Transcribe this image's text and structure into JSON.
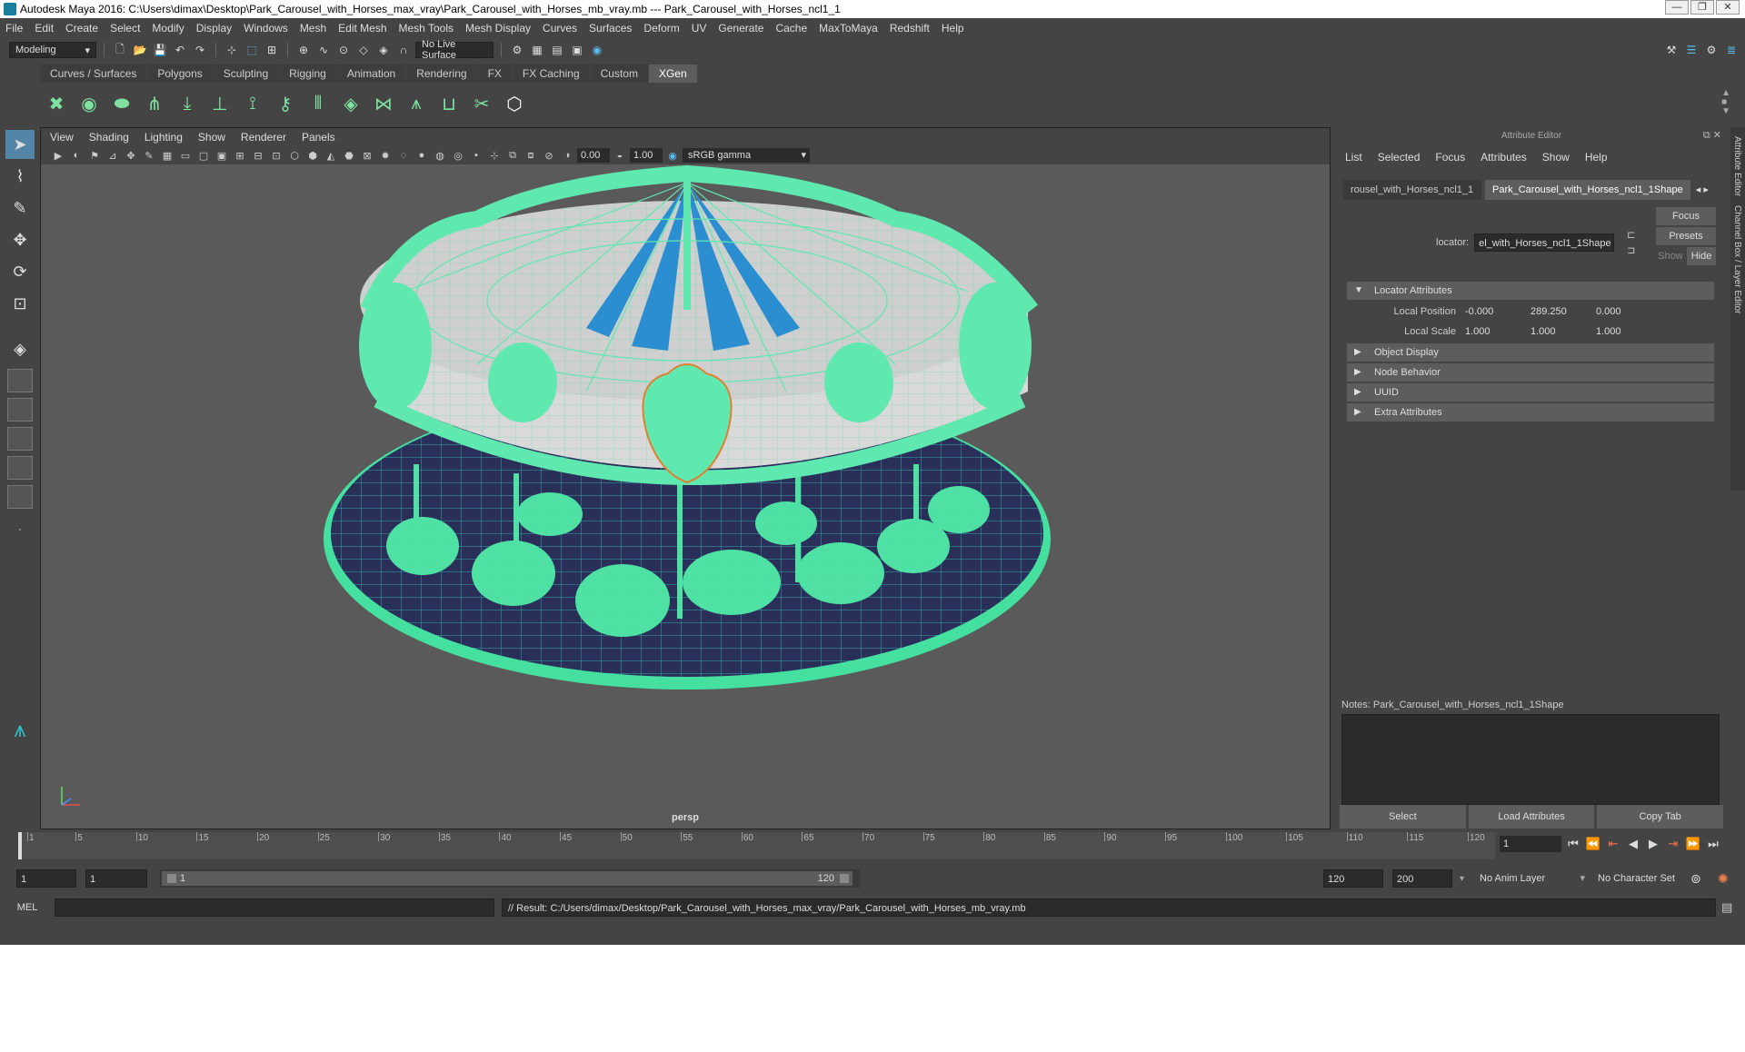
{
  "titlebar": {
    "title": "Autodesk Maya 2016: C:\\Users\\dimax\\Desktop\\Park_Carousel_with_Horses_max_vray\\Park_Carousel_with_Horses_mb_vray.mb  ---  Park_Carousel_with_Horses_ncl1_1"
  },
  "menubar": [
    "File",
    "Edit",
    "Create",
    "Select",
    "Modify",
    "Display",
    "Windows",
    "Mesh",
    "Edit Mesh",
    "Mesh Tools",
    "Mesh Display",
    "Curves",
    "Surfaces",
    "Deform",
    "UV",
    "Generate",
    "Cache",
    "MaxToMaya",
    "Redshift",
    "Help"
  ],
  "statusline": {
    "mode": "Modeling",
    "live_surface": "No Live Surface"
  },
  "shelf_tabs": [
    "Curves / Surfaces",
    "Polygons",
    "Sculpting",
    "Rigging",
    "Animation",
    "Rendering",
    "FX",
    "FX Caching",
    "Custom",
    "XGen"
  ],
  "shelf_active": "XGen",
  "viewport": {
    "menus": [
      "View",
      "Shading",
      "Lighting",
      "Show",
      "Renderer",
      "Panels"
    ],
    "exposure": "0.00",
    "gamma": "1.00",
    "colorspace": "sRGB gamma",
    "camera": "persp"
  },
  "attribute_editor": {
    "title": "Attribute Editor",
    "menus": [
      "List",
      "Selected",
      "Focus",
      "Attributes",
      "Show",
      "Help"
    ],
    "tabs": [
      "rousel_with_Horses_ncl1_1",
      "Park_Carousel_with_Horses_ncl1_1Shape"
    ],
    "locator_label": "locator:",
    "locator_value": "el_with_Horses_ncl1_1Shape",
    "focus_btn": "Focus",
    "presets_btn": "Presets",
    "show_btn": "Show",
    "hide_btn": "Hide",
    "sections": {
      "locator": "Locator Attributes",
      "object_display": "Object Display",
      "node_behavior": "Node Behavior",
      "uuid": "UUID",
      "extra": "Extra Attributes"
    },
    "local_position": {
      "label": "Local Position",
      "x": "-0.000",
      "y": "289.250",
      "z": "0.000"
    },
    "local_scale": {
      "label": "Local Scale",
      "x": "1.000",
      "y": "1.000",
      "z": "1.000"
    },
    "notes_label": "Notes:  Park_Carousel_with_Horses_ncl1_1Shape",
    "bottom_buttons": [
      "Select",
      "Load Attributes",
      "Copy Tab"
    ],
    "side_tabs": [
      "Attribute Editor",
      "Channel Box / Layer Editor"
    ]
  },
  "timeline": {
    "ticks": [
      "1",
      "5",
      "10",
      "15",
      "20",
      "25",
      "30",
      "35",
      "40",
      "45",
      "50",
      "55",
      "60",
      "65",
      "70",
      "75",
      "80",
      "85",
      "90",
      "95",
      "100",
      "105",
      "110",
      "115",
      "120"
    ],
    "current_frame": "1"
  },
  "range": {
    "start": "1",
    "playback_start": "1",
    "slider_start": "1",
    "slider_end": "120",
    "playback_end": "120",
    "end": "200",
    "anim_layer": "No Anim Layer",
    "char_set": "No Character Set"
  },
  "command": {
    "label": "MEL",
    "result": "// Result: C:/Users/dimax/Desktop/Park_Carousel_with_Horses_max_vray/Park_Carousel_with_Horses_mb_vray.mb"
  }
}
